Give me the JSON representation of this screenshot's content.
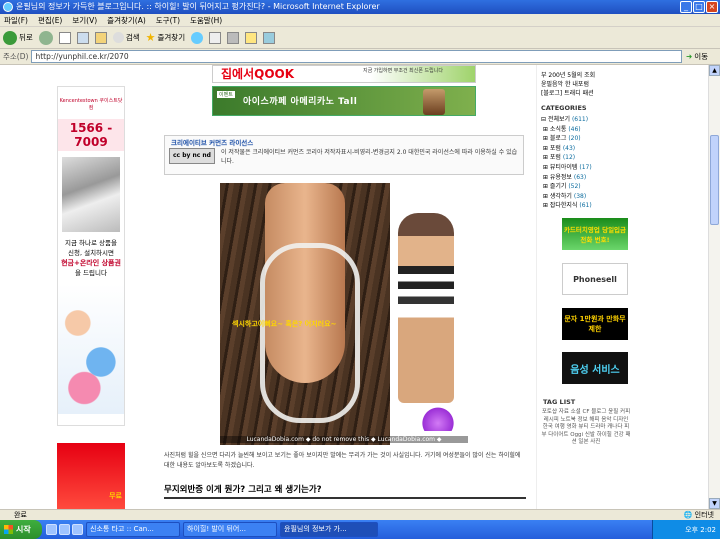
{
  "window": {
    "title": "윤필님의 정보가 가득한 블로그입니다. :: 하이힐! 발이 뒤어지고 펑가진다? - Microsoft Internet Explorer"
  },
  "menu": [
    "파일(F)",
    "편집(E)",
    "보기(V)",
    "즐겨찾기(A)",
    "도구(T)",
    "도움말(H)"
  ],
  "toolbar": {
    "back": "뒤로",
    "search": "검색",
    "favorites": "즐겨찾기"
  },
  "address": {
    "label": "주소(D)",
    "url": "http://yunphil.ce.kr/2070",
    "go": "이동"
  },
  "left_ad": {
    "brand": "Kencentestown 쿠이스트닷컴",
    "phone": "1566 - 7009",
    "line1": "지금 하나로 상품을",
    "line2": "신청, 설치하시면",
    "line3": "현금+온라인 상품권",
    "line4": "을 드립니다",
    "bottom": "무료"
  },
  "banner1": {
    "main": "집에서QOOK",
    "sub": "지금 가입하면 무조건\n최신폰 드립니다"
  },
  "banner2": {
    "tag": "이벤트",
    "text": "아이스까페 아메리카노 Tall"
  },
  "cc": {
    "heading": "크리에이티브 커먼즈 라이선스",
    "badge": "cc by nc nd",
    "desc": "이 저작물은 크리에이티브 커먼즈 코리아 저작자표시-비영리-변경금지 2.0 대한민국 라이선스에 따라 이용하실 수 있습니다."
  },
  "photo": {
    "caption": "섹시하고이뻐요~ 혹은? 어지러요~",
    "watermark": "LucandaDobia.com ◆ do not remove this ◆ LucandaDobia.com ◆"
  },
  "article": {
    "body": "사진처럼 힐을 신으면 다리가 늘씬해 보이고 보기는 좋아 보이지만 발에는 무리가 가는 것이 사실입니다. 거기에 여성분들이 많이 신는 하이힐에 대한 내용도 알아보도록 하겠습니다.",
    "subhead": "무지외반증 이게 뭔가? 그리고 왜 생기는가?"
  },
  "sidebar": {
    "recent": [
      "부 200년 5월의 조회",
      "윤필음악 한 내포럼",
      "[블로그] 트래디 패션"
    ],
    "categories_title": "CATEGORIES",
    "categories": [
      {
        "label": "전체보기",
        "count": "(611)"
      },
      {
        "label": "소식통",
        "count": "(46)"
      },
      {
        "label": "블로그",
        "count": "(20)"
      },
      {
        "label": "포럼",
        "count": "(43)"
      },
      {
        "label": "포럼",
        "count": "(12)"
      },
      {
        "label": "뷰티아이템",
        "count": "(17)"
      },
      {
        "label": "유용정보",
        "count": "(63)"
      },
      {
        "label": "즐기기",
        "count": "(52)"
      },
      {
        "label": "생각하기",
        "count": "(38)"
      },
      {
        "label": "잡다한지식",
        "count": "(61)"
      }
    ],
    "ads": [
      "카드터치영업 당일입금 전화 번호!",
      "Phonesell",
      "문자 1만원과 만화무제한",
      "음성 서비스"
    ],
    "taglist_title": "TAG LIST",
    "tags": "포토샵 자료 소셜 CF 블로그 윤필 커피 레시피 노트북 정보 해피 음악 디자인 한국 여행 영화 뷰티 드라마 캐나다 피부 다이어트 Oggi 신발 하이힐 건강 패션 일본 사진"
  },
  "status": {
    "left": "완료",
    "zone": "인터넷"
  },
  "taskbar": {
    "start": "시작",
    "tasks": [
      "신소통 타고 :: Can...",
      "하이힐! 발이 뒤어...",
      "윤필님의 정보가 가..."
    ],
    "clock": "오후 2:02"
  },
  "colors": {
    "titlebar": "#245edb",
    "accent_red": "#e60012",
    "link_blue": "#1d50a8"
  }
}
